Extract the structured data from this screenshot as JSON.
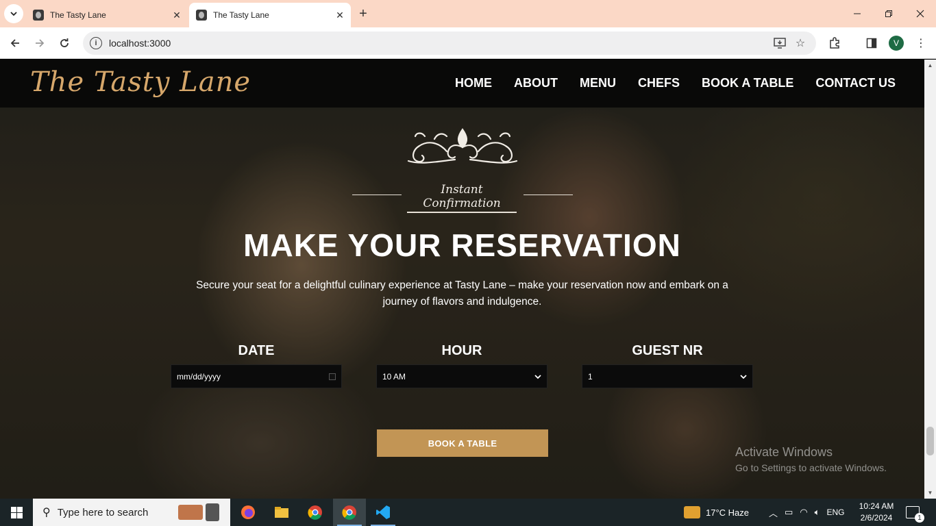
{
  "browser": {
    "tabs": [
      {
        "title": "The Tasty Lane",
        "active": false
      },
      {
        "title": "The Tasty Lane",
        "active": true
      }
    ],
    "url": "localhost:3000",
    "profile_initial": "V"
  },
  "site": {
    "brand": "The Tasty Lane",
    "nav": [
      "HOME",
      "ABOUT",
      "MENU",
      "CHEFS",
      "BOOK A TABLE",
      "CONTACT US"
    ],
    "brand_color": "#d6a76b",
    "accent_color": "#c29555"
  },
  "hero": {
    "tagline": "Instant Confirmation",
    "title": "MAKE YOUR RESERVATION",
    "description": "Secure your seat for a delightful culinary experience at Tasty Lane – make your reservation now and embark on a journey of flavors and indulgence."
  },
  "form": {
    "date": {
      "label": "DATE",
      "placeholder": "mm/dd/yyyy"
    },
    "hour": {
      "label": "HOUR",
      "value": "10 AM"
    },
    "guests": {
      "label": "GUEST NR",
      "value": "1"
    },
    "submit": "BOOK A TABLE"
  },
  "watermark": {
    "title": "Activate Windows",
    "subtitle": "Go to Settings to activate Windows."
  },
  "taskbar": {
    "search_placeholder": "Type here to search",
    "weather": "17°C  Haze",
    "language": "ENG",
    "time": "10:24 AM",
    "date": "2/6/2024",
    "notification_count": "1"
  }
}
